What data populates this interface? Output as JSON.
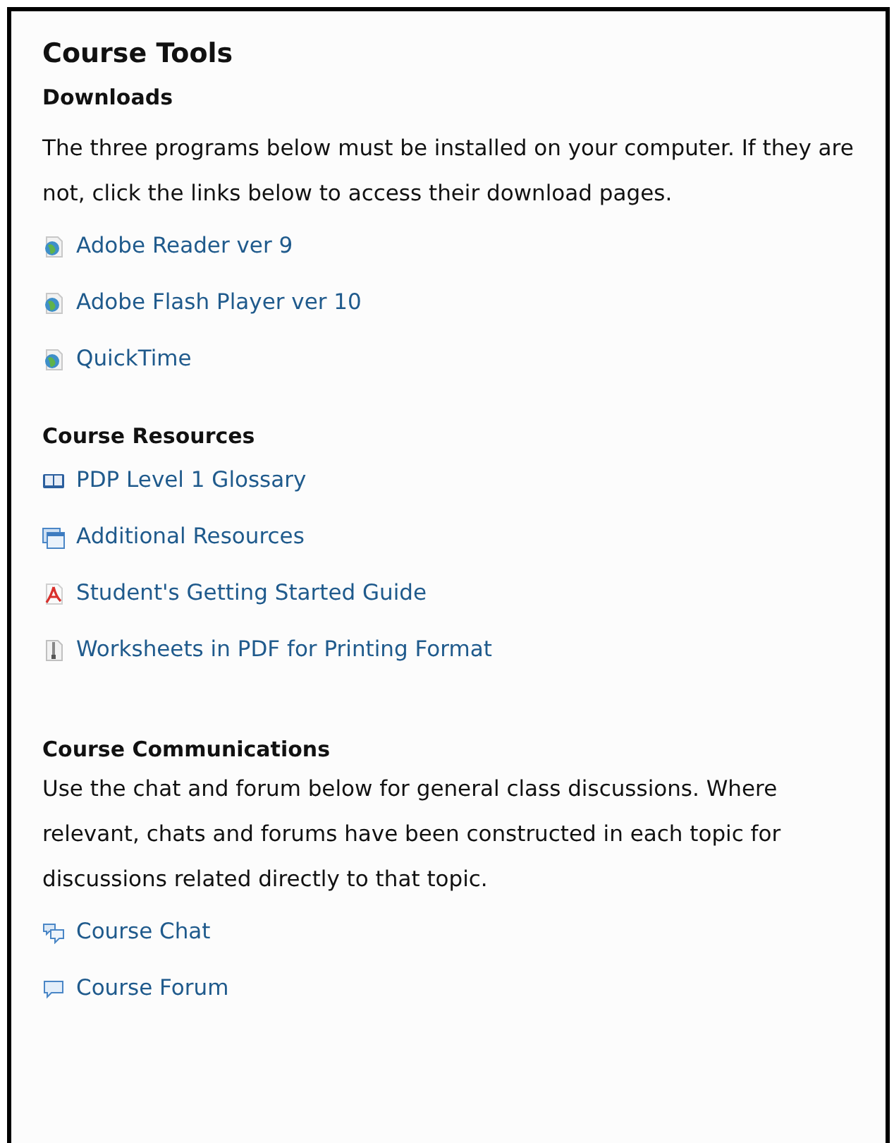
{
  "title": "Course Tools",
  "sections": [
    {
      "heading": "Downloads",
      "text": "The three programs below must be installed on your computer. If they are not, click the links below to access their download pages.",
      "links": [
        {
          "label": "Adobe Reader ver 9",
          "kind": "globe"
        },
        {
          "label": "Adobe Flash Player ver 10",
          "kind": "globe"
        },
        {
          "label": "QuickTime",
          "kind": "globe"
        }
      ]
    },
    {
      "heading": "Course Resources",
      "links": [
        {
          "label": "PDP Level 1 Glossary",
          "kind": "book"
        },
        {
          "label": "Additional Resources",
          "kind": "window"
        },
        {
          "label": "Student's Getting Started Guide",
          "kind": "pdf"
        },
        {
          "label": "Worksheets in PDF for Printing Format",
          "kind": "zip"
        }
      ]
    },
    {
      "heading": "Course Communications",
      "text": "Use the chat and forum below for general class discussions. Where relevant, chats and forums have been constructed in each topic for discussions related directly to that topic.",
      "links": [
        {
          "label": "Course Chat",
          "kind": "chat"
        },
        {
          "label": "Course Forum",
          "kind": "forum"
        }
      ]
    }
  ]
}
